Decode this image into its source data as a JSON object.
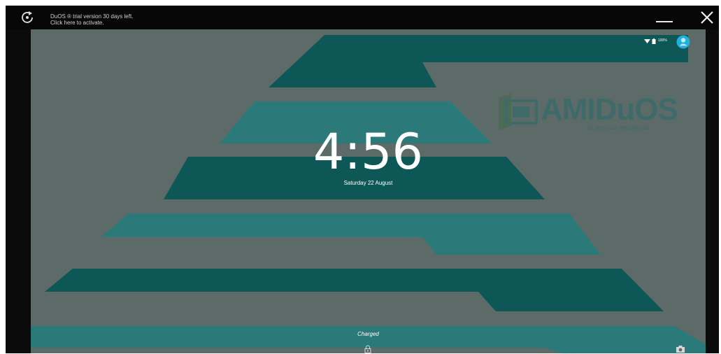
{
  "window": {
    "trial_line1": "DuOS ® trial version 30 days left.",
    "trial_line2": "Click here to activate."
  },
  "status_bar": {
    "battery_percent": "100%"
  },
  "brand": {
    "name": "AMIDuOS",
    "tagline": "by american megatrends"
  },
  "lockscreen": {
    "time": "4:56",
    "date": "Saturday 22 August",
    "charge_status": "Charged"
  },
  "icons": {
    "refresh": "refresh-icon",
    "minimize": "minimize-icon",
    "close": "close-icon",
    "wifi": "wifi-icon",
    "battery": "battery-icon",
    "avatar": "user-avatar-icon",
    "lock": "lock-icon",
    "camera": "camera-icon"
  },
  "colors": {
    "background": "#5c6a68",
    "teal_dark": "#0d5757",
    "teal_light": "#2c7979",
    "accent": "#1fb0dc"
  }
}
